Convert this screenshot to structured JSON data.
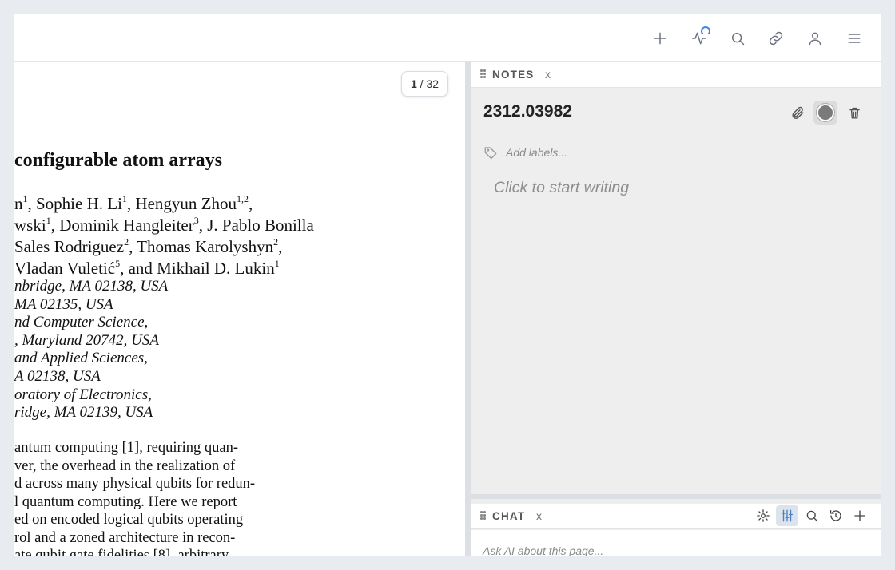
{
  "toolbar": {
    "icons": [
      "plus-icon",
      "activity-icon",
      "search-icon",
      "link-icon",
      "user-icon",
      "menu-icon"
    ]
  },
  "pdf": {
    "page_counter": {
      "current": "1",
      "separator": " / ",
      "total": "32"
    },
    "title": "configurable atom arrays",
    "authors": [
      [
        "n",
        "1",
        ", Sophie H. Li",
        "1",
        ", Hengyun Zhou",
        "1,2",
        ","
      ],
      [
        "wski",
        "1",
        ", Dominik Hangleiter",
        "3",
        ", J. Pablo Bonilla",
        "",
        ""
      ],
      [
        "Sales Rodriguez",
        "2",
        ", Thomas Karolyshyn",
        "2",
        ",",
        "",
        ""
      ],
      [
        "Vladan Vuletić",
        "5",
        ", and Mikhail D. Lukin",
        "1",
        "",
        "",
        ""
      ]
    ],
    "affiliations": [
      "nbridge, MA 02138, USA",
      "MA 02135, USA",
      "nd Computer Science,",
      ", Maryland 20742, USA",
      "and Applied Sciences,",
      "A 02138, USA",
      "oratory of Electronics,",
      "ridge, MA 02139, USA"
    ],
    "abstract_lines": [
      "antum computing [1], requiring quan-",
      "ver, the overhead in the realization of",
      "d across many physical qubits for redun-",
      "l quantum computing. Here we report",
      "ed on encoded logical qubits operating",
      "rol and a zoned architecture in recon-",
      "ate qubit gate fidelities [8], arbitrary"
    ]
  },
  "notes": {
    "header": "NOTES",
    "close": "x",
    "note_title": "2312.03982",
    "labels_placeholder": "Add labels...",
    "body_placeholder": "Click to start writing"
  },
  "chat": {
    "header": "CHAT",
    "close": "x",
    "input_placeholder": "Ask AI about this page..."
  },
  "colors": {
    "accent": "#3b82f6",
    "background": "#e8ecf1",
    "panel": "#eeeeee"
  }
}
